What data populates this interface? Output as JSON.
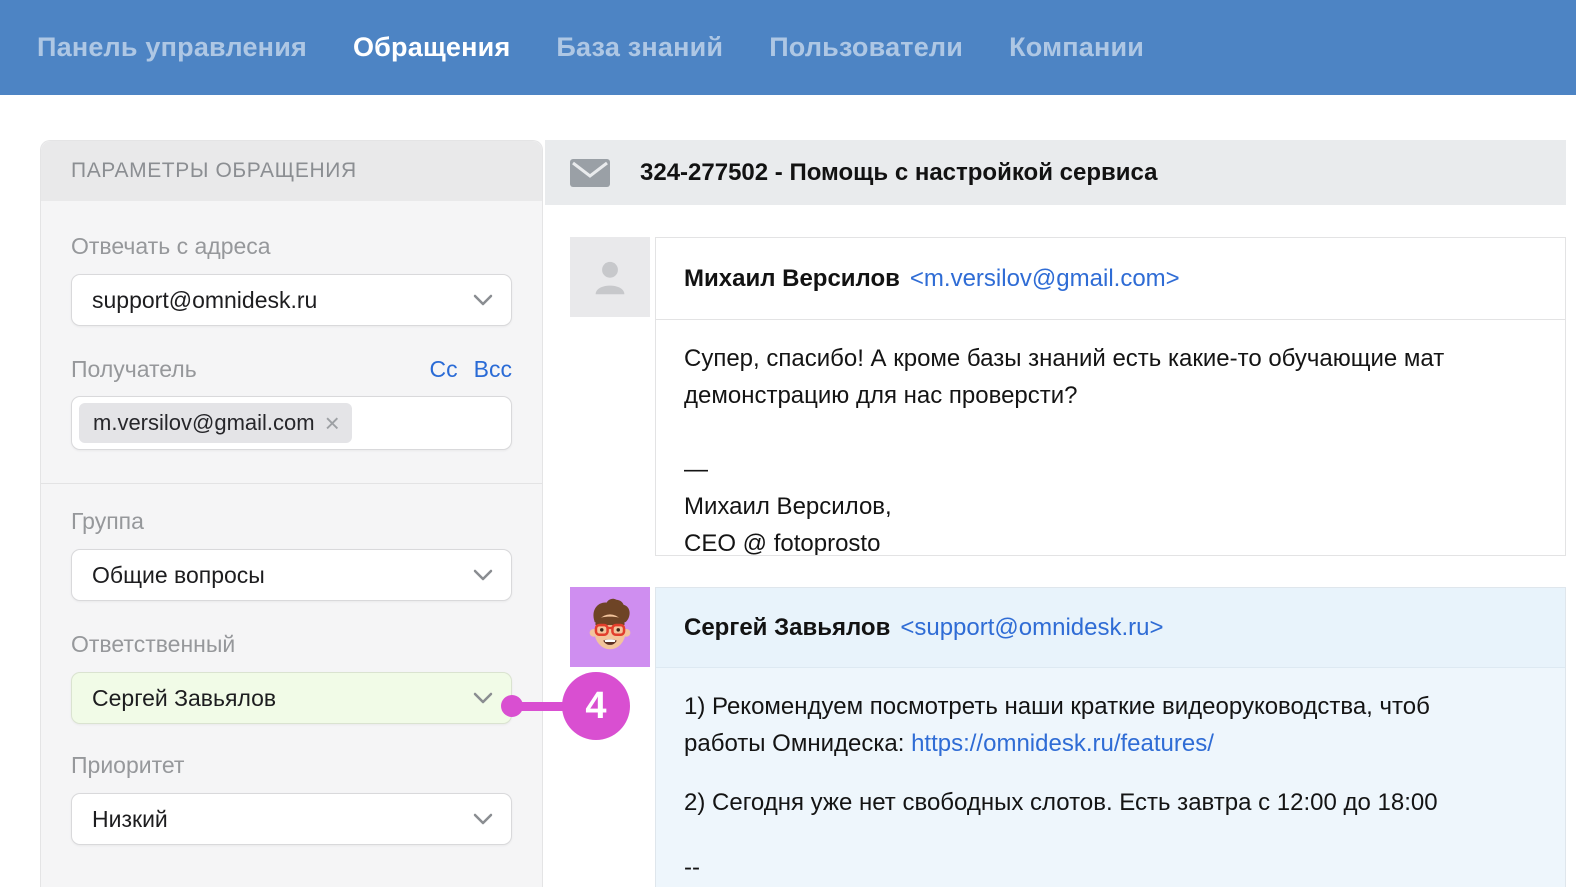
{
  "nav": {
    "items": [
      {
        "label": "Панель управления",
        "active": false
      },
      {
        "label": "Обращения",
        "active": true
      },
      {
        "label": "База знаний",
        "active": false
      },
      {
        "label": "Пользователи",
        "active": false
      },
      {
        "label": "Компании",
        "active": false
      }
    ]
  },
  "sidebar": {
    "title": "ПАРАМЕТРЫ ОБРАЩЕНИЯ",
    "reply_from": {
      "label": "Отвечать с адреса",
      "value": "support@omnidesk.ru"
    },
    "recipient": {
      "label": "Получатель",
      "cc": "Cc",
      "bcc": "Bcc",
      "chip": "m.versilov@gmail.com",
      "remove": "×"
    },
    "group": {
      "label": "Группа",
      "value": "Общие вопросы"
    },
    "assignee": {
      "label": "Ответственный",
      "value": "Сергей Завьялов"
    },
    "priority": {
      "label": "Приоритет",
      "value": "Низкий"
    }
  },
  "ticket": {
    "title": "324-277502 - Помощь с настройкой сервиса"
  },
  "messages": [
    {
      "author": "Михаил Версилов",
      "email": "<m.versilov@gmail.com>",
      "line1": "Супер, спасибо! А кроме базы знаний есть какие-то обучающие мат",
      "line2": "демонстрацию для нас проверсти?",
      "dash": "—",
      "sig1": "Михаил Версилов,",
      "sig2": "CEO @ fotoprosto"
    },
    {
      "author": "Сергей Завьялов",
      "email": "<support@omnidesk.ru>",
      "p1_line1": "1) Рекомендуем посмотреть наши краткие видеоруководства, чтоб",
      "p1_line2_prefix": "работы Омнидеска: ",
      "p1_link": "https://omnidesk.ru/features/",
      "p2": "2) Сегодня уже нет свободных слотов. Есть завтра с 12:00 до 18:00",
      "sig": "--"
    }
  ],
  "annotation": {
    "step": "4"
  },
  "colors": {
    "nav_blue": "#4d84c4",
    "annotation_pink": "#d94fd1",
    "link_blue": "#2f6cd5",
    "assignee_highlight": "#f1fbe7",
    "avatar_purple": "#cf8ef0",
    "sidebar_bg": "#f5f5f6",
    "ticket_bar_bg": "#e9ebed",
    "agent_msg_bg": "#eef6fc"
  }
}
